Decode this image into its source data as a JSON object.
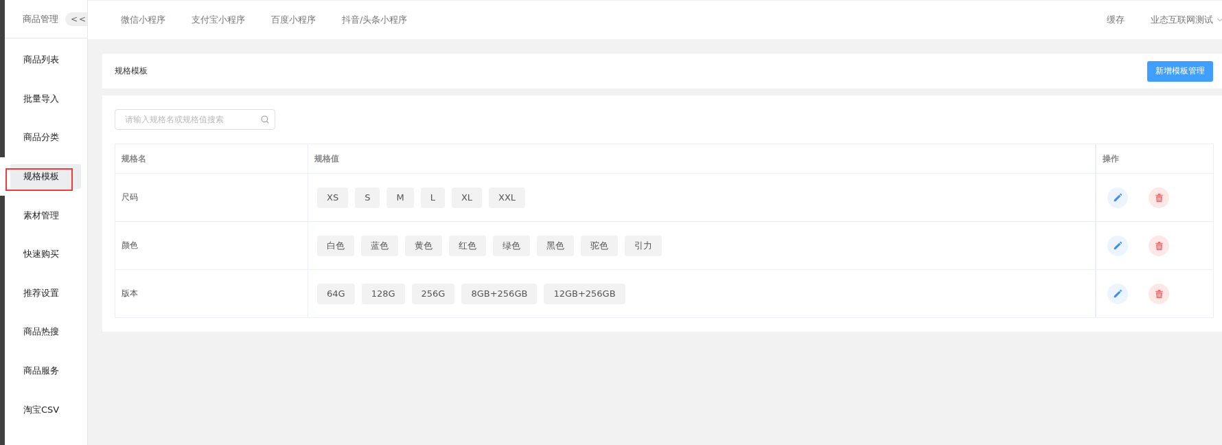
{
  "sidebar": {
    "title": "商品管理",
    "collapse_button": "<<",
    "items": [
      {
        "label": "商品列表",
        "selected": false,
        "highlighted": false
      },
      {
        "label": "批量导入",
        "selected": false,
        "highlighted": false
      },
      {
        "label": "商品分类",
        "selected": false,
        "highlighted": false
      },
      {
        "label": "规格模板",
        "selected": true,
        "highlighted": true
      },
      {
        "label": "素材管理",
        "selected": false,
        "highlighted": false
      },
      {
        "label": "快速购买",
        "selected": false,
        "highlighted": false
      },
      {
        "label": "推荐设置",
        "selected": false,
        "highlighted": false
      },
      {
        "label": "商品热搜",
        "selected": false,
        "highlighted": false
      },
      {
        "label": "商品服务",
        "selected": false,
        "highlighted": false
      },
      {
        "label": "淘宝CSV",
        "selected": false,
        "highlighted": false
      }
    ]
  },
  "top_nav": {
    "tabs": [
      "微信小程序",
      "支付宝小程序",
      "百度小程序",
      "抖音/头条小程序"
    ],
    "cache": "缓存",
    "account": "业态互联网测试"
  },
  "page_header": {
    "title": "规格模板",
    "add_button": "新增模板管理"
  },
  "search": {
    "placeholder": "请输入规格名或规格值搜索"
  },
  "table": {
    "columns": [
      "规格名",
      "规格值",
      "操作"
    ],
    "rows": [
      {
        "name": "尺码",
        "values": [
          "XS",
          "S",
          "M",
          "L",
          "XL",
          "XXL"
        ]
      },
      {
        "name": "颜色",
        "values": [
          "白色",
          "蓝色",
          "黄色",
          "红色",
          "绿色",
          "黑色",
          "驼色",
          "引力"
        ]
      },
      {
        "name": "版本",
        "values": [
          "64G",
          "128G",
          "256G",
          "8GB+256GB",
          "12GB+256GB"
        ]
      }
    ]
  }
}
